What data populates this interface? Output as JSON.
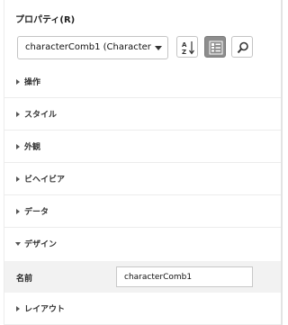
{
  "panel": {
    "title": "プロパティ(R)",
    "selector_value": "characterComb1 (Character C...",
    "toolbar": [
      {
        "icon": "sort-az-icon"
      },
      {
        "icon": "categorized-view-icon"
      },
      {
        "icon": "search-icon"
      }
    ]
  },
  "sections": {
    "s0": "操作",
    "s1": "スタイル",
    "s2": "外観",
    "s3": "ビヘイビア",
    "s4": "データ",
    "s5": "デザイン",
    "s6": "レイアウト"
  },
  "design": {
    "name_label": "名前",
    "name_value": "characterComb1"
  },
  "colors": {
    "active_button": "#8d8d8d",
    "property_row_bg": "#f2f2f2"
  }
}
